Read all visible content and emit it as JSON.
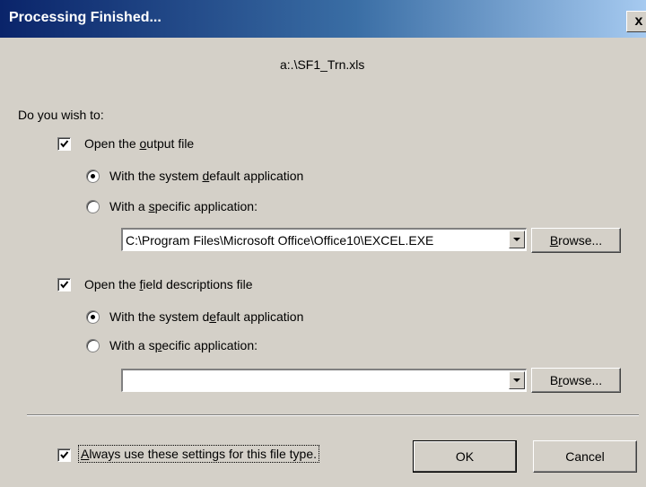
{
  "window": {
    "title": "Processing Finished...",
    "close_glyph": "x"
  },
  "file_path": "a:.\\SF1_Trn.xls",
  "prompt": "Do you wish to:",
  "output_section": {
    "checkbox_label": {
      "pre": "Open the ",
      "u": "o",
      "post": "utput file"
    },
    "checked": true,
    "radio_default": {
      "pre": "With the system ",
      "u": "d",
      "post": "efault application",
      "selected": true
    },
    "radio_specific": {
      "pre": "With a ",
      "u": "s",
      "post": "pecific application:",
      "selected": false
    },
    "application_path": "C:\\Program Files\\Microsoft Office\\Office10\\EXCEL.EXE",
    "browse": {
      "u": "B",
      "post": "rowse..."
    }
  },
  "field_section": {
    "checkbox_label": {
      "pre": "Open the ",
      "u": "f",
      "post": "ield descriptions file"
    },
    "checked": true,
    "radio_default": {
      "pre": "With the system d",
      "u": "e",
      "post": "fault application",
      "selected": true
    },
    "radio_specific": {
      "pre": "With a s",
      "u": "p",
      "post": "ecific application:",
      "selected": false
    },
    "application_path": "",
    "browse": {
      "pre": "B",
      "u": "r",
      "post": "owse..."
    }
  },
  "always_use": {
    "pre": "",
    "u": "A",
    "post": "lways use these settings for this file type.",
    "checked": true
  },
  "buttons": {
    "ok": "OK",
    "cancel": "Cancel"
  },
  "colors": {
    "face": "#d4d0c8",
    "title_start": "#0a246a",
    "title_end": "#a6caf0"
  }
}
